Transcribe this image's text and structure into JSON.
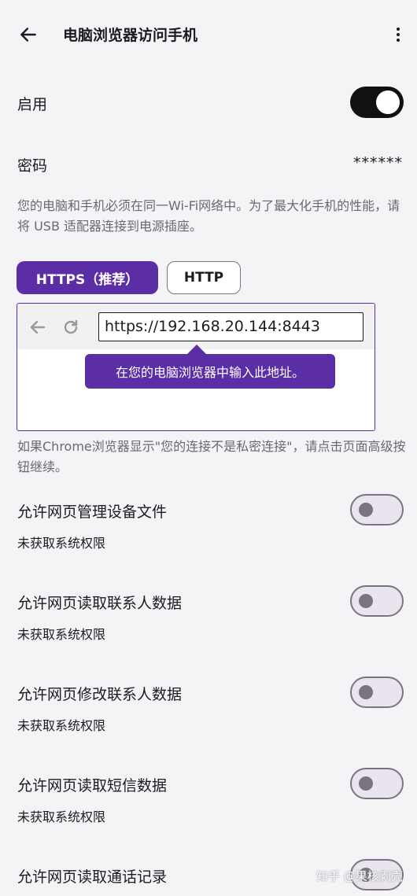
{
  "header": {
    "title": "电脑浏览器访问手机",
    "back_icon": "arrow-left-icon",
    "more_icon": "more-vert-icon"
  },
  "enable": {
    "label": "启用",
    "on": true
  },
  "password": {
    "label": "密码",
    "value": "******"
  },
  "network_hint": "您的电脑和手机必须在同一Wi-Fi网络中。为了最大化手机的性能，请将 USB 适配器连接到电源插座。",
  "tabs": [
    {
      "label": "HTTPS（推荐）",
      "selected": true
    },
    {
      "label": "HTTP",
      "selected": false
    }
  ],
  "browser_preview": {
    "url": "https://192.168.20.144:8443",
    "tooltip": "在您的电脑浏览器中输入此地址。"
  },
  "chrome_hint": "如果Chrome浏览器显示\"您的连接不是私密连接\"，请点击页面高级按钮继续。",
  "permissions": [
    {
      "title": "允许网页管理设备文件",
      "status": "未获取系统权限",
      "on": false
    },
    {
      "title": "允许网页读取联系人数据",
      "status": "未获取系统权限",
      "on": false
    },
    {
      "title": "允许网页修改联系人数据",
      "status": "未获取系统权限",
      "on": false
    },
    {
      "title": "允许网页读取短信数据",
      "status": "未获取系统权限",
      "on": false
    },
    {
      "title": "允许网页读取通话记录",
      "status": "",
      "on": false
    }
  ],
  "watermark": "知乎 @果核剥壳",
  "colors": {
    "accent": "#5b2ea6",
    "background": "#f4f3f6",
    "switch_on": "#111111",
    "switch_off_track": "#e9e4ee"
  }
}
